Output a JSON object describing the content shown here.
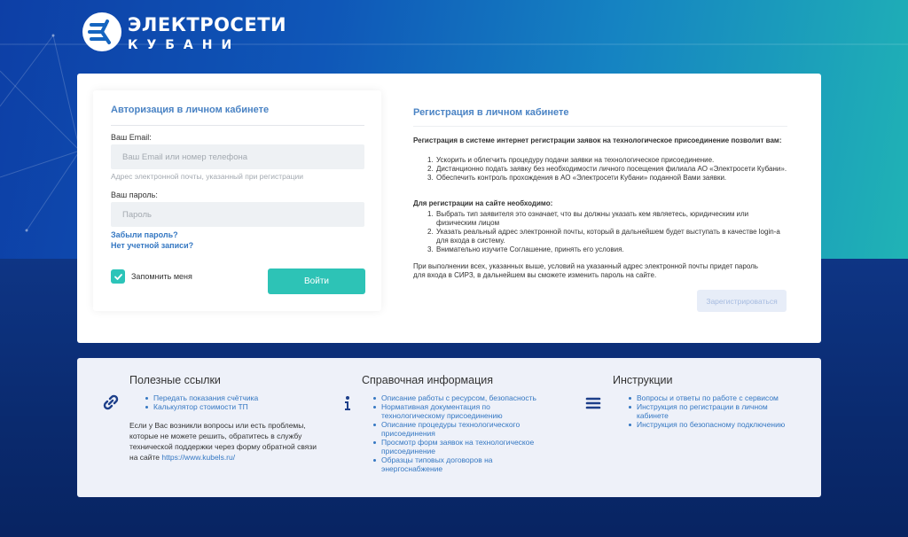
{
  "logo": {
    "line1": "ЭЛЕКТРОСЕТИ",
    "line2": "КУБАНИ",
    "icon": "logo-mark-icon"
  },
  "login": {
    "title": "Авторизация в личном кабинете",
    "email_label": "Ваш Email:",
    "email_placeholder": "Ваш Email или номер телефона",
    "email_hint": "Адрес электронной почты, указанный при регистрации",
    "password_label": "Ваш пароль:",
    "password_placeholder": "Пароль",
    "forgot_link": "Забыли пароль?",
    "no_account_link": "Нет учетной записи?",
    "remember_label": "Запомнить меня",
    "remember_checked": true,
    "login_button": "Войти"
  },
  "registration": {
    "title": "Регистрация в личном кабинете",
    "intro": "Регистрация в системе интернет регистрации заявок на технологическое присоединение позволит вам:",
    "benefits": [
      "Ускорить и облегчить процедуру подачи заявки на технологическое присоединение.",
      "Дистанционно подать заявку без необходимости личного посещения филиала АО «Электросети Кубани».",
      "Обеспечить контроль прохождения в АО «Электросети Кубани» поданной Вами заявки."
    ],
    "requirements_title": "Для регистрации на сайте необходимо:",
    "requirements": [
      "Выбрать тип заявителя это означает, что вы должны указать кем являетесь, юридическим или физическим лицом",
      "Указать реальный адрес электронной почты, который в дальнейшем будет выступать в качестве login-а для входа в систему.",
      "Внимательно изучите Соглашение, принять его условия."
    ],
    "note": "При выполнении всех, указанных выше, условий на указанный адрес электронной почты придет пароль для входа в СИРЗ, в дальнейшем вы сможете изменить пароль на сайте.",
    "register_button": "Зарегистрироваться"
  },
  "useful_links": {
    "title": "Полезные ссылки",
    "icon": "link-icon",
    "links": [
      "Передать показания счётчика",
      "Калькулятор стоимости ТП"
    ],
    "note": "Если у Вас возникли вопросы или есть проблемы, которые не можете решить, обратитесь в службу технической поддержки через форму обратной связи на сайте",
    "site_link": "https://www.kubels.ru/"
  },
  "reference": {
    "title": "Справочная информация",
    "icon": "info-icon",
    "links": [
      "Описание работы с ресурсом, безопасность",
      "Нормативная документация по технологическому присоединению",
      "Описание процедуры технологического присоединения",
      "Просмотр форм заявок на технологическое присоединение",
      "Образцы типовых договоров на энергоснабжение"
    ]
  },
  "instructions": {
    "title": "Инструкции",
    "icon": "list-icon",
    "links": [
      "Вопросы и ответы по работе с сервисом",
      "Инструкция по регистрации в личном кабинете",
      "Инструкция по безопасному подключению"
    ]
  },
  "colors": {
    "accent": "#2dc3b6",
    "link": "#3477c2",
    "title_blue": "#4a83c4",
    "background_dark": "#0c2a6b"
  }
}
